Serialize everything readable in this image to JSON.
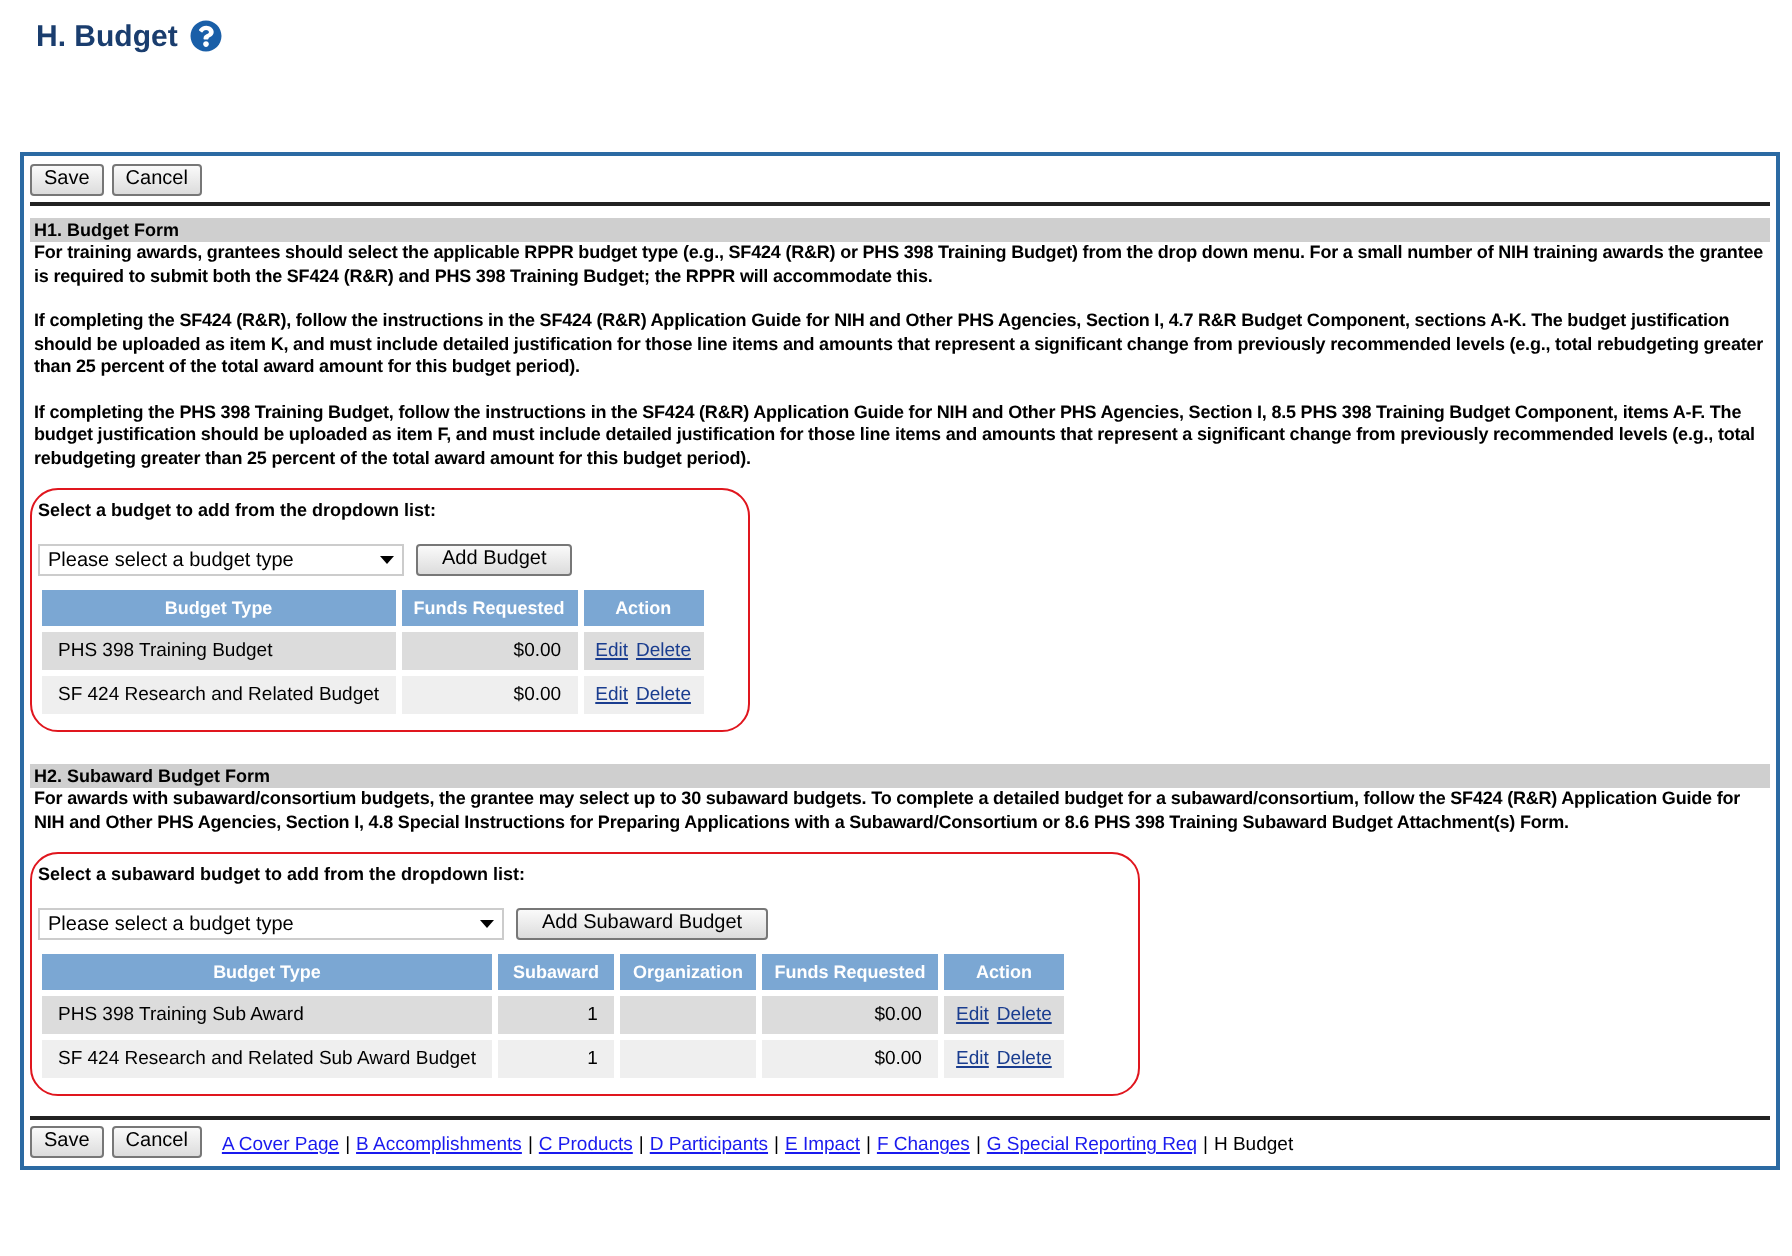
{
  "page_title": "H. Budget",
  "top_buttons": [
    "Save",
    "Cancel"
  ],
  "budget_form": {
    "heading": "H1. Budget Form",
    "paragraphs": [
      "For training awards, grantees should select the applicable RPPR budget type (e.g., SF424 (R&R) or PHS 398 Training Budget) from the drop down menu. For a small number of NIH training awards the grantee is required to submit both the SF424 (R&R) and PHS 398 Training Budget; the RPPR will accommodate this.",
      "If completing the SF424 (R&R), follow the instructions in the SF424 (R&R) Application Guide for NIH and Other PHS Agencies, Section I, 4.7 R&R Budget Component, sections A-K. The budget justification should be uploaded as item K, and must include detailed justification for those line items and amounts that represent a significant change from previously recommended levels (e.g., total rebudgeting greater than 25 percent of the total award amount for this budget period).",
      "If completing the PHS 398 Training Budget, follow the instructions in the SF424 (R&R) Application Guide for NIH and Other PHS Agencies, Section I, 8.5 PHS 398 Training Budget Component, items A-F. The budget justification should be uploaded as item F, and must include detailed justification for those line items and amounts that represent a significant change from previously recommended levels (e.g., total rebudgeting greater than 25 percent of the total award amount for this budget period)."
    ],
    "prompt": "Select a budget to add from the dropdown list:",
    "dropdown": {
      "value": "Please select a budget type"
    },
    "add_button": "Add Budget",
    "table": {
      "columns": [
        "Budget Type",
        "Funds Requested",
        "Action"
      ],
      "rows": [
        {
          "cells": [
            "PHS 398 Training Budget",
            "$0.00"
          ],
          "actions": [
            "Edit",
            "Delete"
          ]
        },
        {
          "cells": [
            "SF 424 Research and Related Budget",
            "$0.00"
          ],
          "actions": [
            "Edit",
            "Delete"
          ]
        }
      ]
    }
  },
  "subaward_form": {
    "heading": "H2. Subaward Budget Form",
    "paragraphs": [
      "For awards with subaward/consortium budgets, the grantee may select up to 30 subaward budgets. To complete a detailed budget for a subaward/consortium, follow the SF424 (R&R) Application Guide for NIH and Other PHS Agencies, Section I, 4.8 Special Instructions for Preparing Applications with a Subaward/Consortium or 8.6 PHS 398 Training Subaward Budget Attachment(s) Form."
    ],
    "prompt": "Select a subaward budget to add from the dropdown list:",
    "dropdown": {
      "value": "Please select a budget type"
    },
    "add_button": "Add Subaward Budget",
    "table": {
      "columns": [
        "Budget Type",
        "Subaward",
        "Organization",
        "Funds Requested",
        "Action"
      ],
      "rows": [
        {
          "cells": [
            "PHS 398 Training Sub Award",
            "1",
            "",
            "$0.00"
          ],
          "actions": [
            "Edit",
            "Delete"
          ]
        },
        {
          "cells": [
            "SF 424 Research and Related Sub Award Budget",
            "1",
            "",
            "$0.00"
          ],
          "actions": [
            "Edit",
            "Delete"
          ]
        }
      ]
    }
  },
  "bottom_buttons": [
    "Save",
    "Cancel"
  ],
  "section_nav": [
    {
      "label": "A Cover Page",
      "selected": false
    },
    {
      "label": "B Accomplishments",
      "selected": false,
      "separator": "|"
    },
    {
      "label": "C Products",
      "selected": false,
      "separator": "|"
    },
    {
      "label": "D Participants",
      "selected": false,
      "separator": "|"
    },
    {
      "label": "E Impact",
      "selected": false,
      "separator": "|"
    },
    {
      "label": "F Changes",
      "selected": false,
      "separator": "|"
    },
    {
      "label": "G Special Reporting Req",
      "selected": false,
      "separator": "|"
    },
    {
      "label": "H Budget",
      "selected": true,
      "separator": "|"
    }
  ]
}
